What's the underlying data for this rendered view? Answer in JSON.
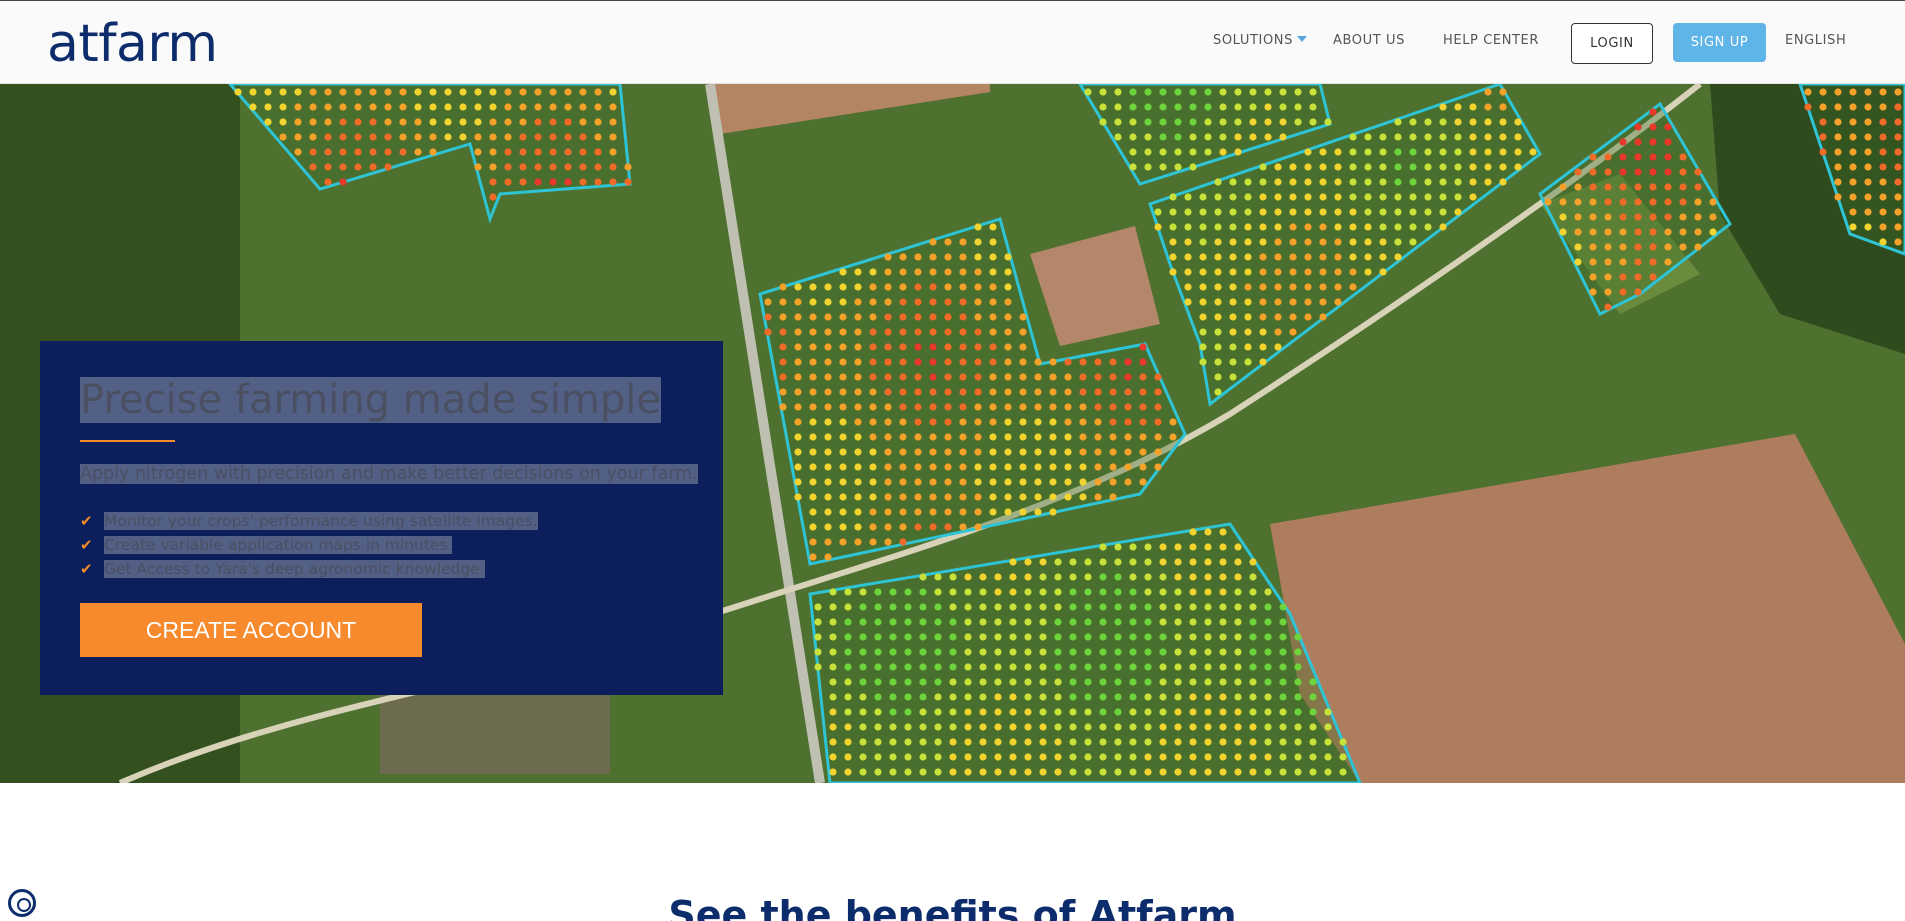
{
  "brand": {
    "name": "atfarm"
  },
  "nav": {
    "solutions": "SOLUTIONS",
    "about": "ABOUT US",
    "help": "HELP CENTER",
    "login": "LOGIN",
    "signup": "SIGN UP",
    "language": "ENGLISH"
  },
  "hero": {
    "title": "Precise farming made simple",
    "subtitle": "Apply nitrogen with precision and make better decisions on your farm.",
    "bullets": [
      "Monitor your crops' performance using satellite images.",
      "Create variable application maps in minutes.",
      "Get Access to Yara's deep agronomic knowledge."
    ],
    "cta": "CREATE ACCOUNT"
  },
  "benefits": {
    "title": "See the benefits of Atfarm"
  },
  "colors": {
    "brand_navy": "#0d2c6c",
    "card_bg": "#0c1f5c",
    "accent_orange": "#f78a2c",
    "signup_blue": "#5fb4e8",
    "field_outline": "#2ec4d6"
  },
  "icons": {
    "check": "checkmark-icon",
    "caret": "caret-down-icon",
    "corner": "accessibility-icon"
  }
}
